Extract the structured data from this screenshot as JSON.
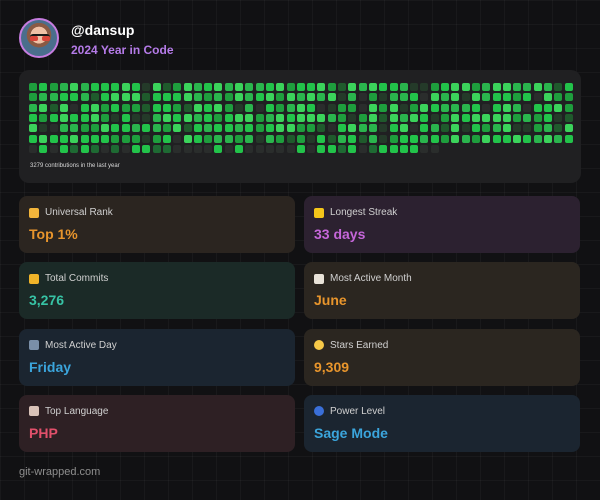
{
  "header": {
    "username": "@dansup",
    "subtitle": "2024 Year in Code"
  },
  "contributions": {
    "summary": "3279 contributions in the last year",
    "rows": 7,
    "cols": 53
  },
  "cards": [
    {
      "name": "universal-rank",
      "label": "Universal Rank",
      "value": "Top 1%",
      "icon": "crown-icon",
      "bg": "#2b2520",
      "color": "#e8952c"
    },
    {
      "name": "longest-streak",
      "label": "Longest Streak",
      "value": "33 days",
      "icon": "lightning-icon",
      "bg": "#2c2130",
      "color": "#c566d9"
    },
    {
      "name": "total-commits",
      "label": "Total Commits",
      "value": "3,276",
      "icon": "trophy-icon",
      "bg": "#1b2a27",
      "color": "#37c3a5"
    },
    {
      "name": "most-active-month",
      "label": "Most Active Month",
      "value": "June",
      "icon": "calendar-icon",
      "bg": "#2b2620",
      "color": "#e8952c"
    },
    {
      "name": "most-active-day",
      "label": "Most Active Day",
      "value": "Friday",
      "icon": "bar-chart-icon",
      "bg": "#1b2530",
      "color": "#3ba5dc"
    },
    {
      "name": "stars-earned",
      "label": "Stars Earned",
      "value": "9,309",
      "icon": "star-icon",
      "bg": "#2b2620",
      "color": "#e8952c"
    },
    {
      "name": "top-language",
      "label": "Top Language",
      "value": "PHP",
      "icon": "rocket-icon",
      "bg": "#2e2024",
      "color": "#e2506b"
    },
    {
      "name": "power-level",
      "label": "Power Level",
      "value": "Sage Mode",
      "icon": "orb-icon",
      "bg": "#1b2530",
      "color": "#3ba5dc"
    }
  ],
  "footer": "git-wrapped.com"
}
